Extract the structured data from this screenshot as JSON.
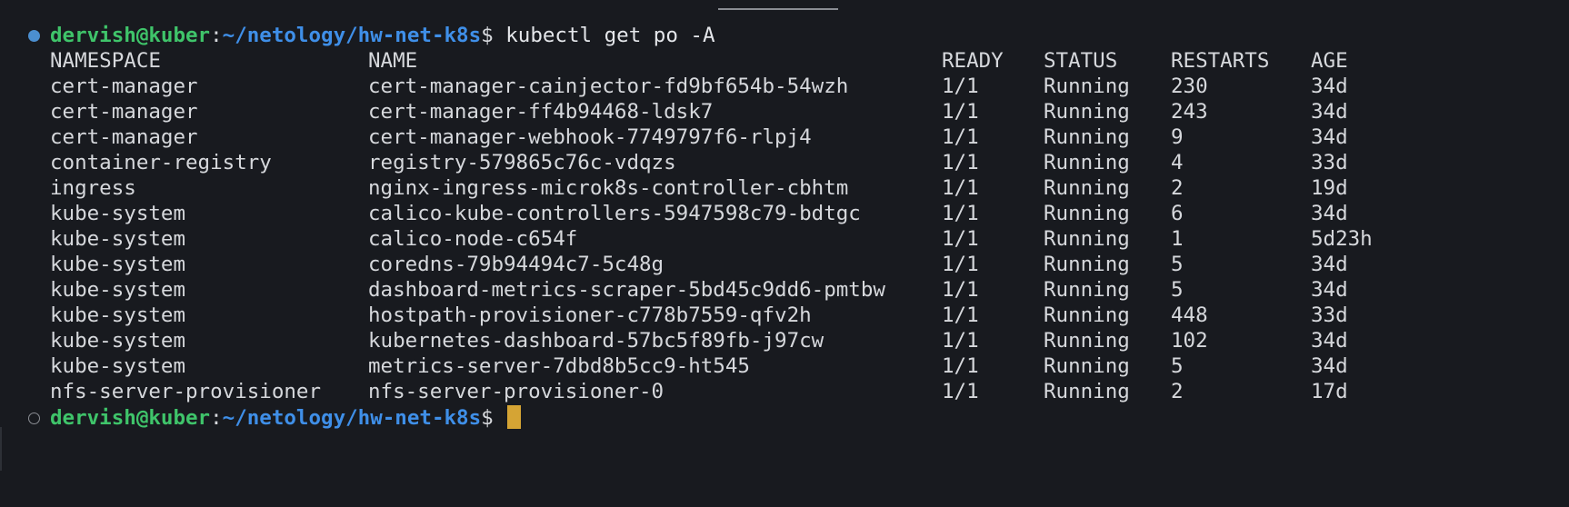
{
  "terminal": {
    "prompt_user": "dervish@kuber",
    "prompt_sep": ":",
    "prompt_path": "~/netology/hw-net-k8s",
    "prompt_dollar": "$",
    "command": " kubectl get po -A",
    "colors": {
      "background": "#181a1f",
      "user": "#3fc46a",
      "path": "#3f8fe8",
      "cursor": "#d5a434",
      "marker_done": "#4b8fd0"
    }
  },
  "table": {
    "headers": [
      "NAMESPACE",
      "NAME",
      "READY",
      "STATUS",
      "RESTARTS",
      "AGE"
    ],
    "rows": [
      [
        "cert-manager",
        "cert-manager-cainjector-fd9bf654b-54wzh",
        "1/1",
        "Running",
        "230",
        "34d"
      ],
      [
        "cert-manager",
        "cert-manager-ff4b94468-ldsk7",
        "1/1",
        "Running",
        "243",
        "34d"
      ],
      [
        "cert-manager",
        "cert-manager-webhook-7749797f6-rlpj4",
        "1/1",
        "Running",
        "9",
        "34d"
      ],
      [
        "container-registry",
        "registry-579865c76c-vdqzs",
        "1/1",
        "Running",
        "4",
        "33d"
      ],
      [
        "ingress",
        "nginx-ingress-microk8s-controller-cbhtm",
        "1/1",
        "Running",
        "2",
        "19d"
      ],
      [
        "kube-system",
        "calico-kube-controllers-5947598c79-bdtgc",
        "1/1",
        "Running",
        "6",
        "34d"
      ],
      [
        "kube-system",
        "calico-node-c654f",
        "1/1",
        "Running",
        "1",
        "5d23h"
      ],
      [
        "kube-system",
        "coredns-79b94494c7-5c48g",
        "1/1",
        "Running",
        "5",
        "34d"
      ],
      [
        "kube-system",
        "dashboard-metrics-scraper-5bd45c9dd6-pmtbw",
        "1/1",
        "Running",
        "5",
        "34d"
      ],
      [
        "kube-system",
        "hostpath-provisioner-c778b7559-qfv2h",
        "1/1",
        "Running",
        "448",
        "33d"
      ],
      [
        "kube-system",
        "kubernetes-dashboard-57bc5f89fb-j97cw",
        "1/1",
        "Running",
        "102",
        "34d"
      ],
      [
        "kube-system",
        "metrics-server-7dbd8b5cc9-ht545",
        "1/1",
        "Running",
        "5",
        "34d"
      ],
      [
        "nfs-server-provisioner",
        "nfs-server-provisioner-0",
        "1/1",
        "Running",
        "2",
        "17d"
      ]
    ]
  }
}
